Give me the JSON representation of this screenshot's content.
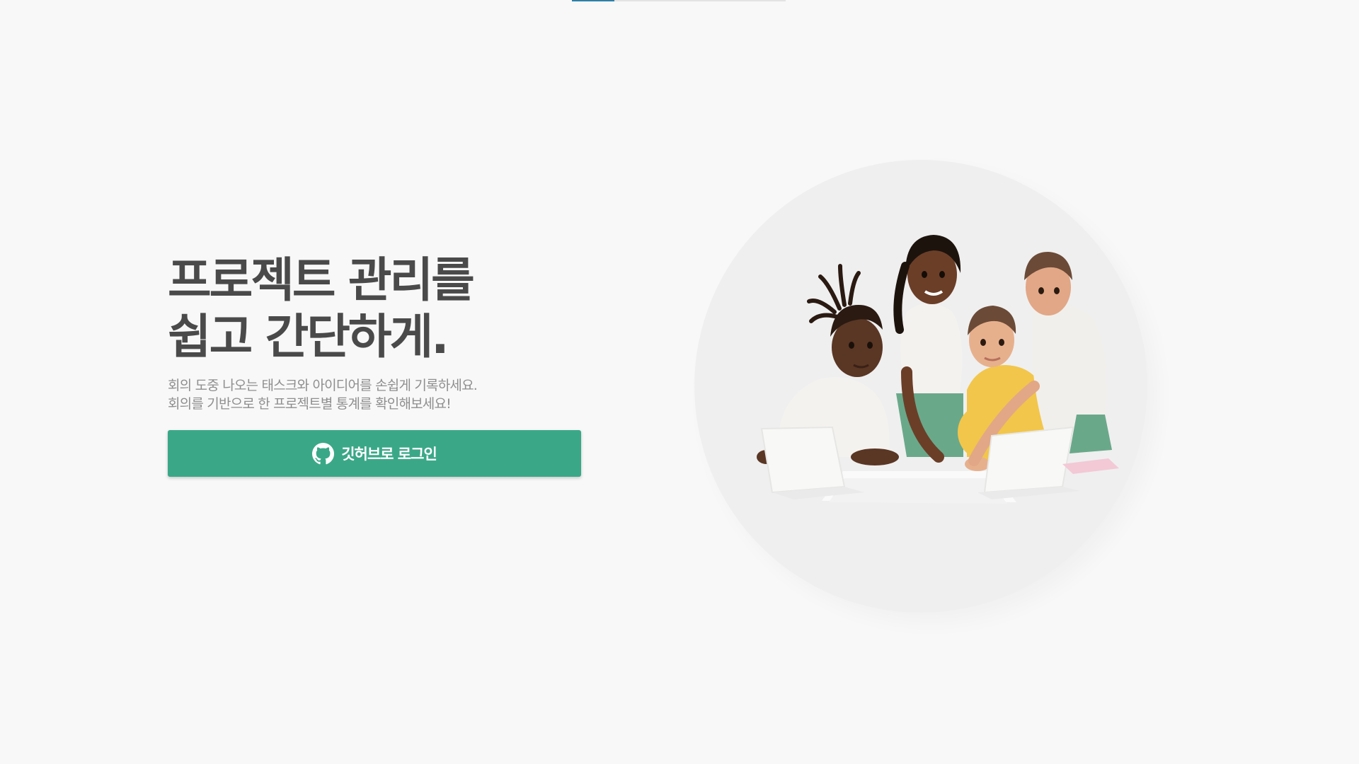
{
  "top_progress": {
    "fraction": 0.2
  },
  "hero": {
    "headline_line1": "프로젝트 관리를",
    "headline_line2": "쉽고 간단하게.",
    "subtitle_line1": "회의 도중 나오는 태스크와 아이디어를 손쉽게 기록하세요.",
    "subtitle_line2": "회의를 기반으로 한 프로젝트별 통계를 확인해보세요!"
  },
  "login": {
    "label": "깃허브로 로그인",
    "icon": "github-icon",
    "color": "#3aa887"
  },
  "illustration": {
    "icon": "team-collaboration-illustration",
    "circle_color": "#efefef"
  },
  "colors": {
    "background": "#f8f8f8",
    "headline": "#4a4a4a",
    "subtitle": "#8e8e8e",
    "accent_bar": "#2d7fa8"
  }
}
